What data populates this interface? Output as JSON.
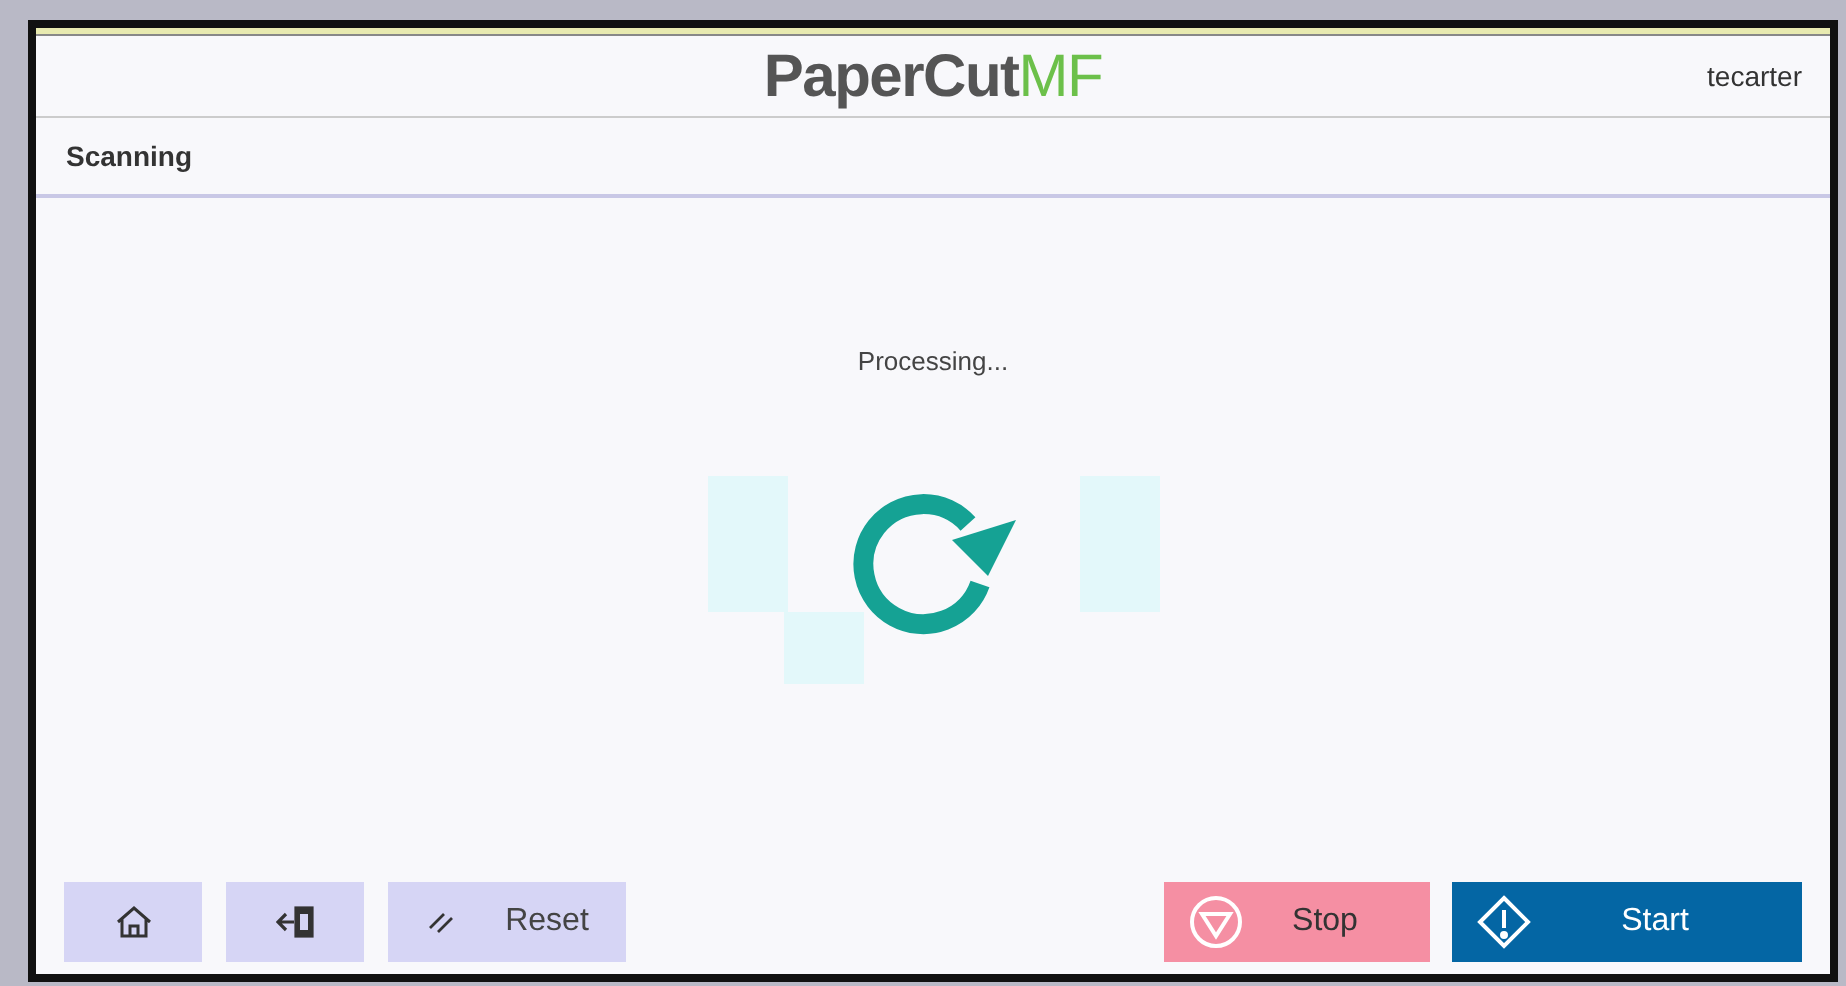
{
  "header": {
    "logo": {
      "main": "PaperCut",
      "suffix": "MF"
    },
    "user": "tecarter"
  },
  "title": "Scanning",
  "status": {
    "message": "Processing..."
  },
  "toolbar": {
    "left": [
      {
        "kind": "home"
      },
      {
        "kind": "logout"
      },
      {
        "kind": "reset",
        "label": "Reset"
      }
    ],
    "right": [
      {
        "kind": "stop",
        "label": "Stop"
      },
      {
        "kind": "start",
        "label": "Start"
      }
    ]
  }
}
